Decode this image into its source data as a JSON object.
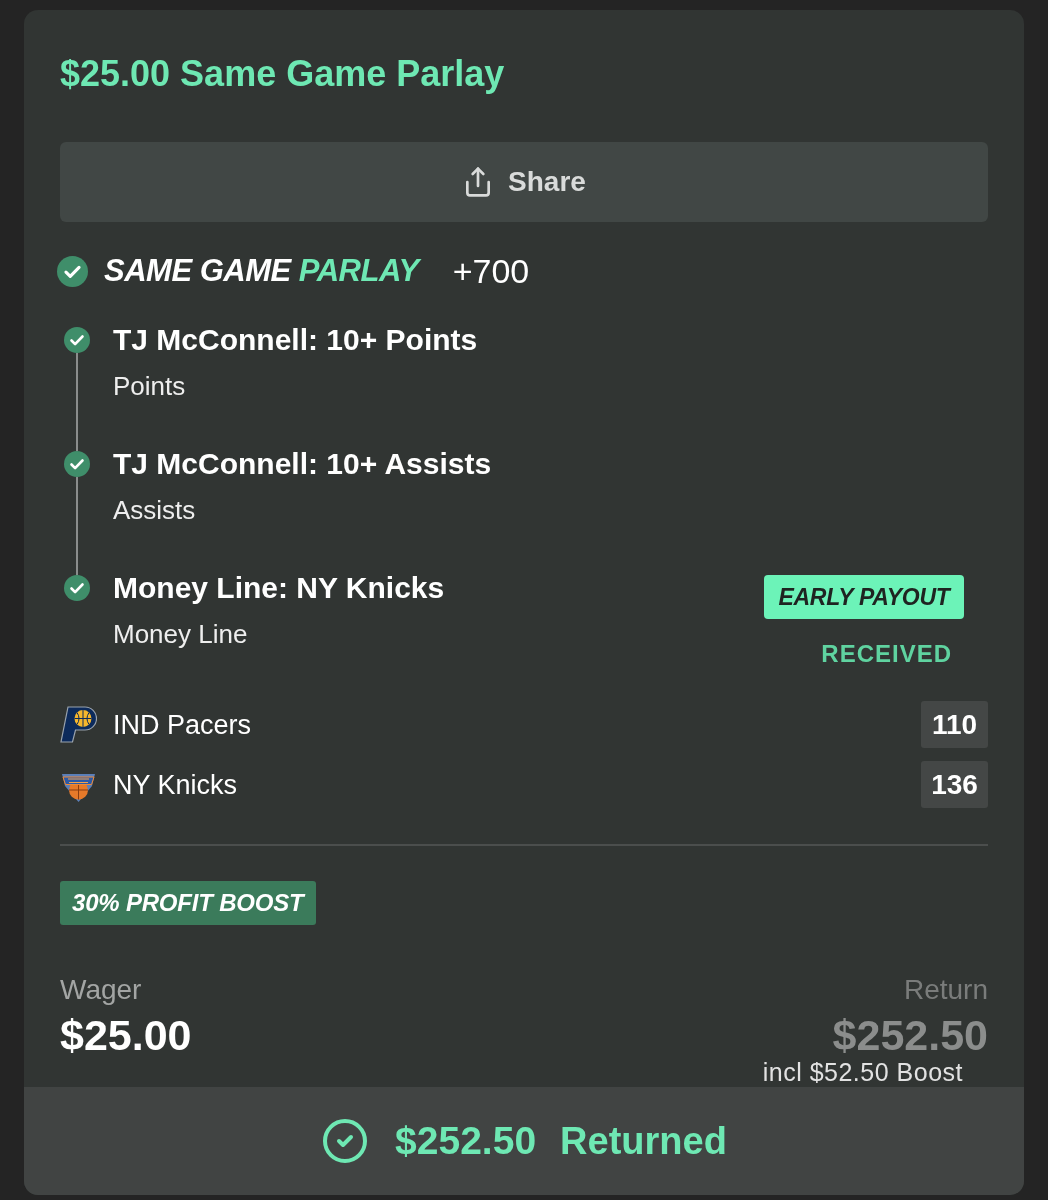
{
  "bet": {
    "title": "$25.00 Same Game Parlay"
  },
  "share_button": {
    "label": "Share"
  },
  "parlay": {
    "won": true,
    "label_parts": [
      {
        "text": "SAME GAME",
        "highlight": false
      },
      {
        "text": "PARLAY",
        "highlight": true
      }
    ],
    "odds": "+700"
  },
  "legs": [
    {
      "title": "TJ McConnell: 10+ Points",
      "market": "Points",
      "won": true
    },
    {
      "title": "TJ McConnell: 10+ Assists",
      "market": "Assists",
      "won": true
    },
    {
      "title": "Money Line: NY Knicks",
      "market": "Money Line",
      "won": true,
      "early_payout": {
        "label": "EARLY PAYOUT",
        "status": "RECEIVED"
      }
    }
  ],
  "teams": [
    {
      "kind": "pshape",
      "name": "IND Pacers",
      "score": "110"
    },
    {
      "kind": "shield",
      "name": "NY Knicks",
      "score": "136"
    }
  ],
  "boost": {
    "label": "30% PROFIT BOOST"
  },
  "wager": {
    "label": "Wager",
    "amount": "$25.00"
  },
  "return": {
    "label": "Return",
    "amount": "$252.50",
    "note": "incl $52.50 Boost"
  },
  "footer": {
    "amount": "$252.50",
    "status": "Returned"
  }
}
